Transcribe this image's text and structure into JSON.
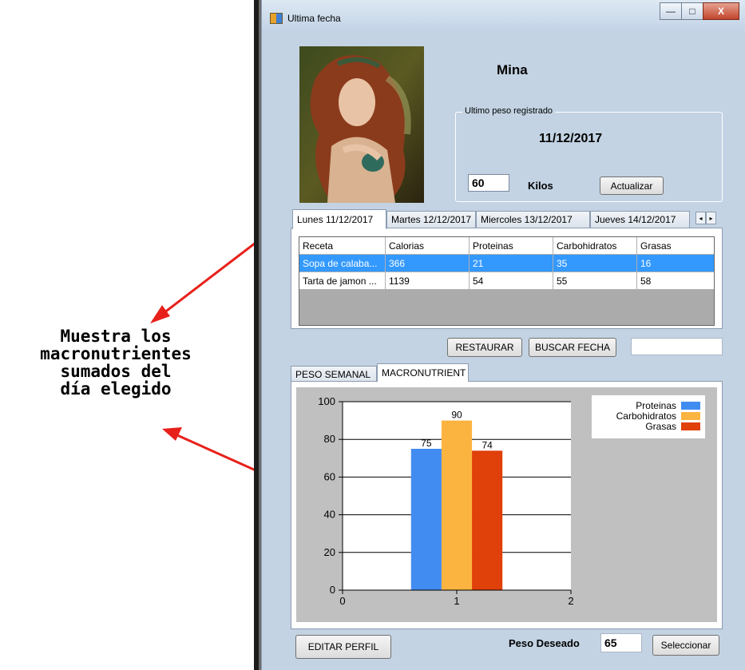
{
  "annotation": {
    "lines": [
      "Muestra los",
      "macronutrientes",
      "sumados del",
      "día elegido"
    ],
    "arrow_color": "#e8201a"
  },
  "window": {
    "title": "Ultima fecha",
    "controls": {
      "minimize": "—",
      "maximize": "□",
      "close": "X"
    }
  },
  "profile": {
    "name": "Mina",
    "weight_group_label": "Ultimo peso registrado",
    "last_date": "11/12/2017",
    "weight_value": "60",
    "weight_unit": "Kilos",
    "update_button": "Actualizar"
  },
  "day_tabs": [
    "Lunes 11/12/2017",
    "Martes 12/12/2017",
    "Miercoles 13/12/2017",
    "Jueves 14/12/2017"
  ],
  "day_tab_scroll": {
    "left": "◂",
    "right": "▸"
  },
  "recipes_table": {
    "columns": [
      "Receta",
      "Calorias",
      "Proteinas",
      "Carbohidratos",
      "Grasas"
    ],
    "rows": [
      [
        "Sopa de calaba...",
        "366",
        "21",
        "35",
        "16"
      ],
      [
        "Tarta de jamon ...",
        "1139",
        "54",
        "55",
        "58"
      ]
    ],
    "selected_row": 0
  },
  "actions": {
    "restore_button": "RESTAURAR",
    "search_date_button": "BUSCAR FECHA",
    "search_date_value": ""
  },
  "chart_tabs": [
    "PESO SEMANAL",
    "MACRONUTRIENT"
  ],
  "chart_data": {
    "type": "bar",
    "x": [
      1
    ],
    "xlim": [
      0,
      2
    ],
    "ylim": [
      0,
      100
    ],
    "yticks": [
      0,
      20,
      40,
      60,
      80,
      100
    ],
    "xticks": [
      0,
      1,
      2
    ],
    "grid": true,
    "legend_position": "top-right",
    "series": [
      {
        "name": "Proteinas",
        "values": [
          75
        ],
        "color": "#418cf0"
      },
      {
        "name": "Carbohidratos",
        "values": [
          90
        ],
        "color": "#fcb441"
      },
      {
        "name": "Grasas",
        "values": [
          74
        ],
        "color": "#e0400a"
      }
    ]
  },
  "footer": {
    "edit_profile_button": "EDITAR PERFIL",
    "desired_weight_label": "Peso Deseado",
    "desired_weight_value": "65",
    "select_button": "Seleccionar"
  }
}
